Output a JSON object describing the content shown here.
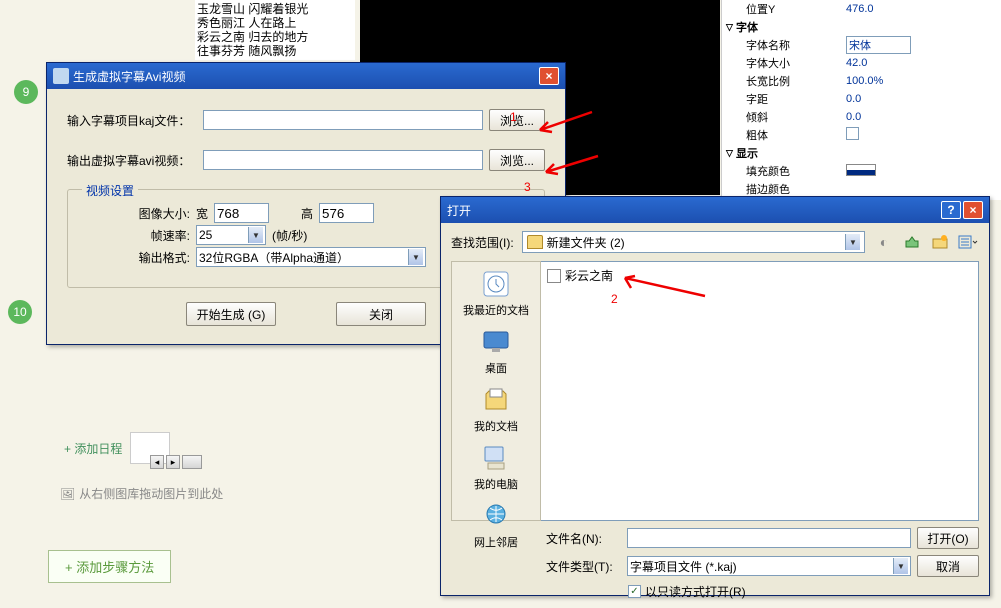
{
  "bg_list": [
    "玉龙雪山  闪耀着银光",
    "秀色丽江  人在路上",
    "彩云之南  归去的地方",
    "往事芬芳  随风飘扬"
  ],
  "step_badges": {
    "a": "9",
    "b": "10"
  },
  "props": {
    "position_y_label": "位置Y",
    "position_y": "476.0",
    "font_header": "字体",
    "font_name_label": "字体名称",
    "font_name": "宋体",
    "font_size_label": "字体大小",
    "font_size": "42.0",
    "ratio_label": "长宽比例",
    "ratio": "100.0%",
    "spacing_label": "字距",
    "spacing": "0.0",
    "skew_label": "倾斜",
    "skew": "0.0",
    "bold_label": "粗体",
    "display_header": "显示",
    "fill_label": "填充颜色",
    "stroke_label": "描边颜色"
  },
  "dlg1": {
    "title": "生成虚拟字幕Avi视频",
    "input_label": "输入字幕项目kaj文件：",
    "input_value": "",
    "output_label": "输出虚拟字幕avi视频：",
    "output_value": "",
    "browse": "浏览...",
    "fieldset": "视频设置",
    "image_size_label": "图像大小:",
    "width_label": "宽",
    "width": "768",
    "height_label": "高",
    "height": "576",
    "fps_label": "帧速率:",
    "fps_value": "25",
    "fps_unit": "(帧/秒)",
    "format_label": "输出格式:",
    "format_value": "32位RGBA（带Alpha通道）",
    "start": "开始生成 (G)",
    "close": "关闭"
  },
  "red": {
    "n1": "1",
    "n2": "2",
    "n3": "3"
  },
  "dlg2": {
    "title": "打开",
    "lookin_label": "查找范围(I):",
    "lookin_value": "新建文件夹 (2)",
    "places": {
      "recent": "我最近的文档",
      "desktop": "桌面",
      "mydocs": "我的文档",
      "mycomp": "我的电脑",
      "network": "网上邻居"
    },
    "file_item": "彩云之南",
    "filename_label": "文件名(N):",
    "filename_value": "",
    "filetype_label": "文件类型(T):",
    "filetype_value": "字幕项目文件 (*.kaj)",
    "open_btn": "打开(O)",
    "cancel_btn": "取消",
    "readonly_label": "以只读方式打开(R)"
  },
  "behind": {
    "add_link": "+ 添加日程"
  },
  "hint": "从右侧图库拖动图片到此处",
  "add_step": "+ 添加步骤方法"
}
